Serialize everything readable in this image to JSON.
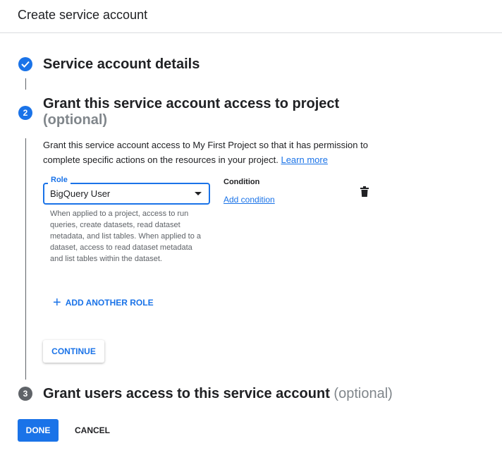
{
  "header": {
    "title": "Create service account"
  },
  "step1": {
    "title": "Service account details",
    "icon": "check-icon"
  },
  "step2": {
    "number": "2",
    "title": "Grant this service account access to project",
    "optional": "(optional)",
    "description": "Grant this service account access to My First Project so that it has permission to complete specific actions on the resources in your project.",
    "learn_more": "Learn more",
    "role": {
      "label": "Role",
      "value": "BigQuery User",
      "helper": "When applied to a project, access to run queries, create datasets, read dataset metadata, and list tables. When applied to a dataset, access to read dataset metadata and list tables within the dataset."
    },
    "condition": {
      "label": "Condition",
      "add_link": "Add condition"
    },
    "delete_icon": "trash-icon",
    "add_role": "ADD ANOTHER ROLE",
    "continue": "CONTINUE"
  },
  "step3": {
    "number": "3",
    "title": "Grant users access to this service account",
    "optional": "(optional)"
  },
  "footer": {
    "done": "DONE",
    "cancel": "CANCEL"
  },
  "colors": {
    "accent": "#1a73e8",
    "inactive_step": "#5f6368",
    "muted": "#80868b"
  }
}
